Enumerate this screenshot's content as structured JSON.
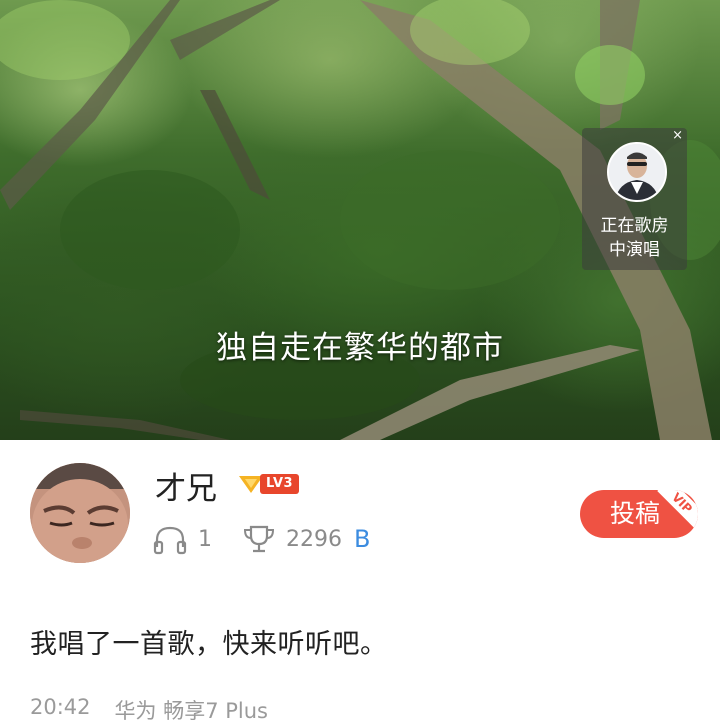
{
  "video": {
    "lyric": "独自走在繁华的都市",
    "live_card": {
      "close_icon": "close-icon",
      "status_line1": "正在歌房",
      "status_line2": "中演唱"
    }
  },
  "profile": {
    "username": "才兄",
    "level_label": "LV3",
    "listen_icon": "headphones-icon",
    "listen_count": "1",
    "trophy_icon": "trophy-icon",
    "trophy_count": "2296",
    "currency": "B",
    "submit_label": "投稿",
    "vip_label": "VIP"
  },
  "post": {
    "text": "我唱了一首歌，快来听听吧。",
    "time": "20:42",
    "device": "华为 畅享7 Plus"
  },
  "colors": {
    "accent": "#ef5243",
    "level_badge": "#e8462c",
    "currency_blue": "#3c8ce0",
    "text_gray": "#8a8a8a"
  }
}
